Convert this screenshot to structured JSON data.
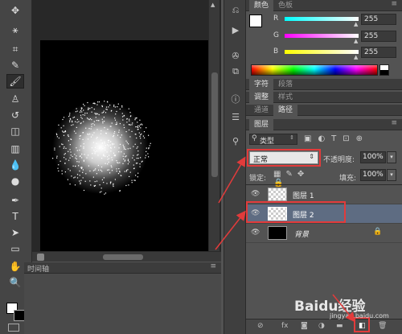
{
  "toolbar": {
    "tools": [
      "move-icon",
      "marquee-icon",
      "lasso-icon",
      "magic-wand-icon",
      "crop-icon",
      "eyedropper-icon",
      "spot-heal-icon",
      "brush-icon",
      "stamp-icon",
      "history-brush-icon",
      "eraser-icon",
      "gradient-icon",
      "blur-icon",
      "dodge-icon",
      "pen-icon",
      "type-icon",
      "path-select-icon",
      "shape-icon",
      "hand-icon",
      "zoom-icon"
    ]
  },
  "color_panel": {
    "tabs": [
      "颜色",
      "色板"
    ],
    "r_label": "R",
    "r_value": "255",
    "g_label": "G",
    "g_value": "255",
    "b_label": "B",
    "b_value": "255"
  },
  "char_panel": {
    "tabs": [
      "字符",
      "段落"
    ]
  },
  "adjust_panel": {
    "tabs": [
      "调整",
      "样式"
    ]
  },
  "channel_panel": {
    "tabs": [
      "通道",
      "路径"
    ]
  },
  "layers_panel": {
    "tab": "图层",
    "filter_label": "类型",
    "blend_mode": "正常",
    "opacity_label": "不透明度:",
    "opacity_value": "100%",
    "lock_label": "锁定:",
    "fill_label": "填充:",
    "fill_value": "100%",
    "layers": [
      {
        "name": "图层 1",
        "selected": false
      },
      {
        "name": "图层 2",
        "selected": true
      },
      {
        "name": "背景",
        "selected": false
      }
    ]
  },
  "timeline": {
    "tab": "时间轴"
  },
  "watermark": {
    "brand": "Baidu经验",
    "url": "jingyan.baidu.com"
  }
}
